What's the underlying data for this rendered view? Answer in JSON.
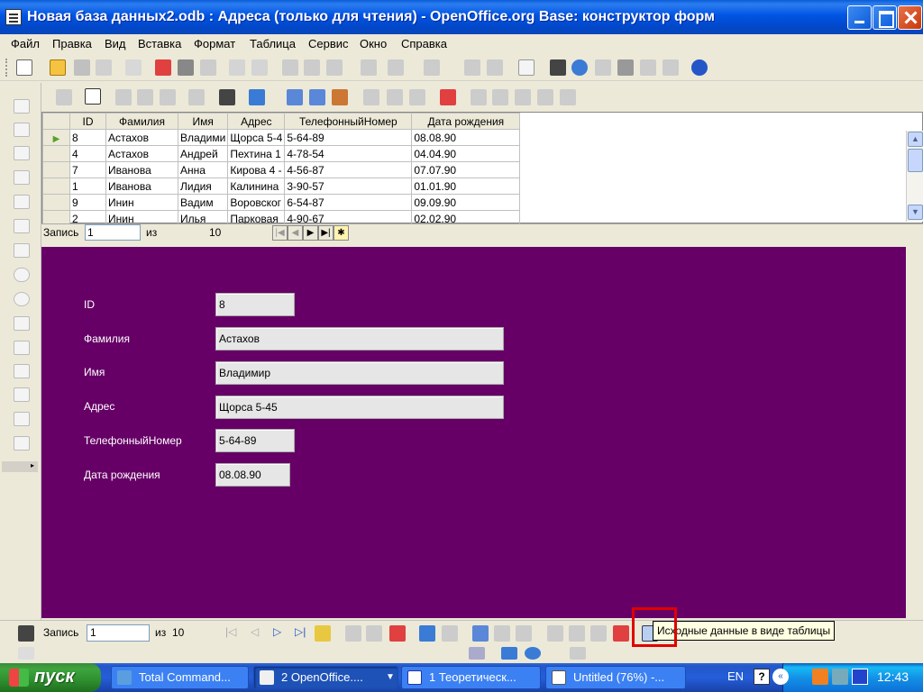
{
  "window": {
    "title": "Новая база данных2.odb : Адреса (только для чтения) - OpenOffice.org Base: конструктор форм"
  },
  "menu": [
    "Файл",
    "Правка",
    "Вид",
    "Вставка",
    "Формат",
    "Таблица",
    "Сервис",
    "Окно",
    "Справка"
  ],
  "grid": {
    "columns": [
      "ID",
      "Фамилия",
      "Имя",
      "Адрес",
      "ТелефонныйНомер",
      "Дата рождения"
    ],
    "rows": [
      [
        "8",
        "Астахов",
        "Владими",
        "Щорса 5-4",
        "5-64-89",
        "08.08.90"
      ],
      [
        "4",
        "Астахов",
        "Андрей",
        "Пехтина 1",
        "4-78-54",
        "04.04.90"
      ],
      [
        "7",
        "Иванова",
        "Анна",
        "Кирова 4 -",
        "4-56-87",
        "07.07.90"
      ],
      [
        "1",
        "Иванова",
        "Лидия",
        "Калинина",
        "3-90-57",
        "01.01.90"
      ],
      [
        "9",
        "Инин",
        "Вадим",
        "Воровског",
        "6-54-87",
        "09.09.90"
      ],
      [
        "2",
        "Инин",
        "Илья",
        "Парковая",
        "4-90-67",
        "02.02.90"
      ]
    ]
  },
  "grid_nav": {
    "record_label": "Запись",
    "record_value": "1",
    "of_label": "из",
    "total": "10"
  },
  "form": {
    "fields": [
      {
        "label": "ID",
        "value": "8"
      },
      {
        "label": "Фамилия",
        "value": "Астахов"
      },
      {
        "label": "Имя",
        "value": "Владимир"
      },
      {
        "label": "Адрес",
        "value": "Щорса 5-45"
      },
      {
        "label": "ТелефонныйНомер",
        "value": "5-64-89"
      },
      {
        "label": "Дата рождения",
        "value": "08.08.90"
      }
    ],
    "background": "#660066"
  },
  "bottom_nav": {
    "record_label": "Запись",
    "record_value": "1",
    "of_label": "из",
    "total": "10"
  },
  "tooltip": "Исходные данные в виде таблицы",
  "taskbar": {
    "start_label": "пуск",
    "tasks": [
      "Total Command...",
      "2 OpenOffice....",
      "1 Теоретическ...",
      "Untitled (76%) -..."
    ],
    "lang": "EN",
    "clock": "12:43"
  }
}
